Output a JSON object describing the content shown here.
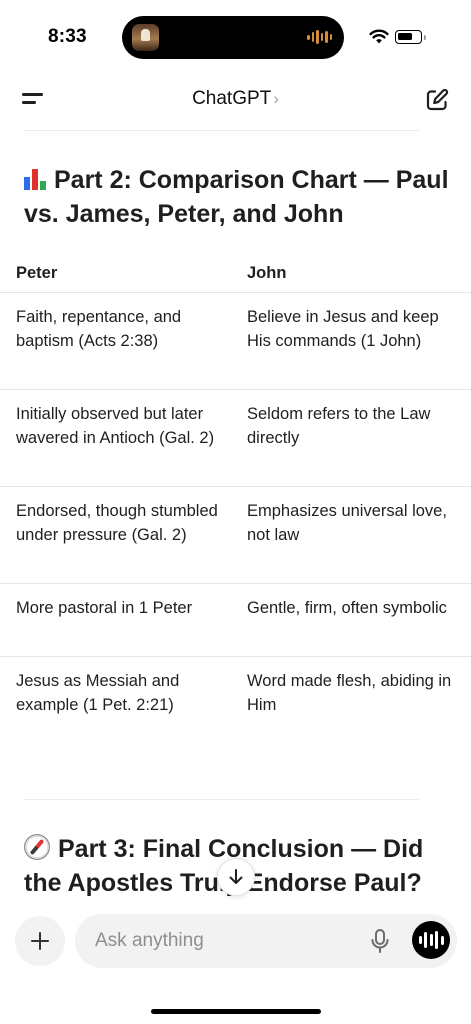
{
  "status_bar": {
    "time": "8:33"
  },
  "nav": {
    "title": "ChatGPT",
    "chevron": "›"
  },
  "content": {
    "part2_heading": "Part 2: Comparison Chart — Paul vs. James, Peter, and John",
    "table": {
      "headers": [
        "Peter",
        "John"
      ],
      "rows": [
        [
          "Faith, repentance, and baptism (Acts 2:38)",
          "Believe in Jesus and keep His commands (1 John)"
        ],
        [
          "Initially observed but later wavered in Antioch (Gal. 2)",
          "Seldom refers to the Law directly"
        ],
        [
          "Endorsed, though stumbled under pressure (Gal. 2)",
          "Emphasizes universal love, not law"
        ],
        [
          "More pastoral in 1 Peter",
          "Gentle, firm, often symbolic"
        ],
        [
          "Jesus as Messiah and example (1 Pet. 2:21)",
          "Word made flesh, abiding in Him"
        ]
      ]
    },
    "part3_heading": "Part 3: Final Conclusion — Did the Apostles Truly Endorse Paul?"
  },
  "composer": {
    "placeholder": "Ask anything"
  },
  "icons": {
    "menu": "menu-icon",
    "compose": "compose-icon",
    "chart_emoji": "bar-chart-emoji-icon",
    "compass_emoji": "compass-emoji-icon",
    "scroll_down": "arrow-down-icon",
    "plus": "plus-icon",
    "mic": "microphone-icon",
    "voice": "voice-mode-icon"
  }
}
